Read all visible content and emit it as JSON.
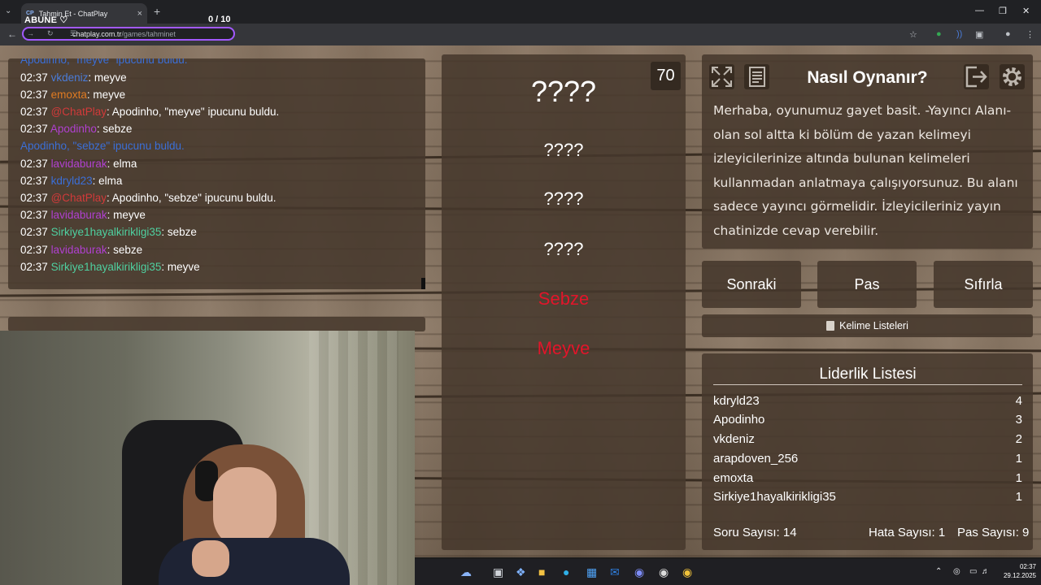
{
  "browser": {
    "tab_title": "Tahmin Et - ChatPlay",
    "tab_favicon": "CP",
    "url_domain": "chatplay.com.tr",
    "url_path": "/games/tahminet",
    "overlay_label": "ABUNE ♡",
    "overlay_counter": "0  / 10"
  },
  "chat": {
    "messages": [
      {
        "time": "",
        "user": "Apodinho, \"meyve\" ipucunu buldu.",
        "text": "",
        "style": "system-blue",
        "color": "#3b6fd8"
      },
      {
        "time": "02:37",
        "user": "vkdeniz",
        "text": ": meyve",
        "color": "#4a7cd9"
      },
      {
        "time": "02:37",
        "user": "emoxta",
        "text": ": meyve",
        "color": "#e07b22"
      },
      {
        "time": "02:37",
        "user": "@ChatPlay",
        "text": ": Apodinho, \"meyve\" ipucunu buldu.",
        "color": "#d23a3a"
      },
      {
        "time": "02:37",
        "user": "Apodinho",
        "text": ": sebze",
        "color": "#b040d0"
      },
      {
        "time": "",
        "user": "Apodinho, \"sebze\" ipucunu buldu.",
        "text": "",
        "style": "system-blue",
        "color": "#3b6fd8"
      },
      {
        "time": "02:37",
        "user": "lavidaburak",
        "text": ": elma",
        "color": "#b040d0"
      },
      {
        "time": "02:37",
        "user": "kdryld23",
        "text": ": elma",
        "color": "#3b6fd8"
      },
      {
        "time": "02:37",
        "user": "@ChatPlay",
        "text": ": Apodinho, \"sebze\" ipucunu buldu.",
        "color": "#d23a3a"
      },
      {
        "time": "02:37",
        "user": "lavidaburak",
        "text": ": meyve",
        "color": "#b040d0"
      },
      {
        "time": "02:37",
        "user": "Sirkiye1hayalkirikligi35",
        "text": ": sebze",
        "color": "#4fd0a0"
      },
      {
        "time": "02:37",
        "user": "lavidaburak",
        "text": ": sebze",
        "color": "#b040d0"
      },
      {
        "time": "02:37",
        "user": "Sirkiye1hayalkirikligi35",
        "text": ": meyve",
        "color": "#4fd0a0"
      }
    ]
  },
  "game": {
    "score": "70",
    "main_word": "????",
    "hidden_words": [
      "????",
      "????",
      "????"
    ],
    "found_words": [
      "Sebze",
      "Meyve"
    ]
  },
  "howto": {
    "title": "Nasıl Oynanır?",
    "text": "Merhaba, oyunumuz gayet basit. -Yayıncı Alanı- olan sol altta ki bölüm de yazan kelimeyi izleyicilerinize altında bulunan kelimeleri kullanmadan anlatmaya çalışıyorsunuz. Bu alanı sadece yayıncı görmelidir. İzleyicileriniz yayın chatinizde cevap verebilir."
  },
  "controls": {
    "next": "Sonraki",
    "pass": "Pas",
    "reset": "Sıfırla",
    "word_lists": "Kelime Listeleri"
  },
  "leaderboard": {
    "title": "Liderlik Listesi",
    "rows": [
      {
        "name": "kdryld23",
        "score": "4"
      },
      {
        "name": "Apodinho",
        "score": "3"
      },
      {
        "name": "vkdeniz",
        "score": "2"
      },
      {
        "name": "arapdoven_256",
        "score": "1"
      },
      {
        "name": "emoxta",
        "score": "1"
      },
      {
        "name": "Sirkiye1hayalkirikligi35",
        "score": "1"
      }
    ],
    "question_count": "Soru Sayısı: 14",
    "error_count": "Hata Sayısı: 1",
    "pass_count": "Pas Sayısı: 9"
  },
  "taskbar": {
    "time": "02:37",
    "date": "29.12.2025"
  }
}
